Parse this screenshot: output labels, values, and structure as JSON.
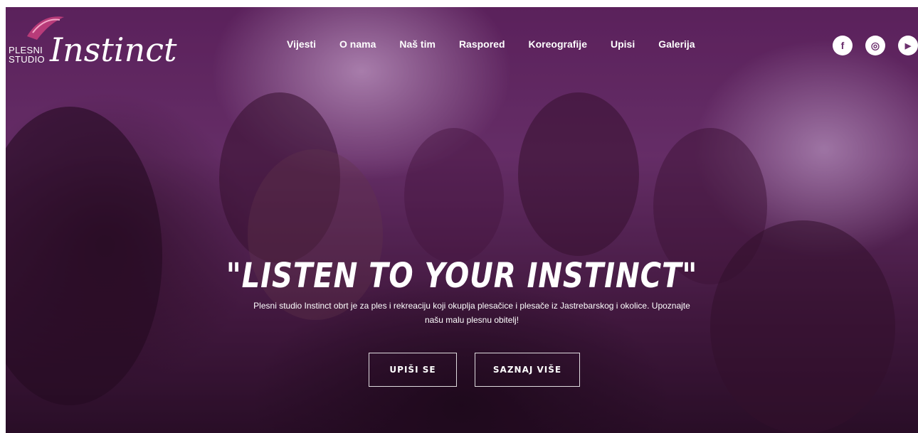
{
  "brand": {
    "small_line1": "PLESNI",
    "small_line2": "STUDIO",
    "script_name": "Instinct"
  },
  "nav": {
    "items": [
      {
        "label": "Vijesti"
      },
      {
        "label": "O nama"
      },
      {
        "label": "Naš tim"
      },
      {
        "label": "Raspored"
      },
      {
        "label": "Koreografije"
      },
      {
        "label": "Upisi"
      },
      {
        "label": "Galerija"
      }
    ]
  },
  "social": {
    "icons": [
      "facebook-icon",
      "instagram-icon",
      "youtube-icon"
    ],
    "facebook_glyph": "f",
    "instagram_glyph": "◎",
    "youtube_glyph": "▶"
  },
  "hero": {
    "headline": "\"LISTEN TO YOUR INSTINCT\"",
    "description": "Plesni studio Instinct obrt je za ples i rekreaciju koji okuplja plesačice i plesače iz Jastrebarskog i okolice. Upoznajte našu malu plesnu obitelj!",
    "primary_button": "UPIŠI SE",
    "secondary_button": "SAZNAJ VIŠE"
  },
  "colors": {
    "accent": "#6b2f6d",
    "hero_tint": "#7d3b7f"
  }
}
